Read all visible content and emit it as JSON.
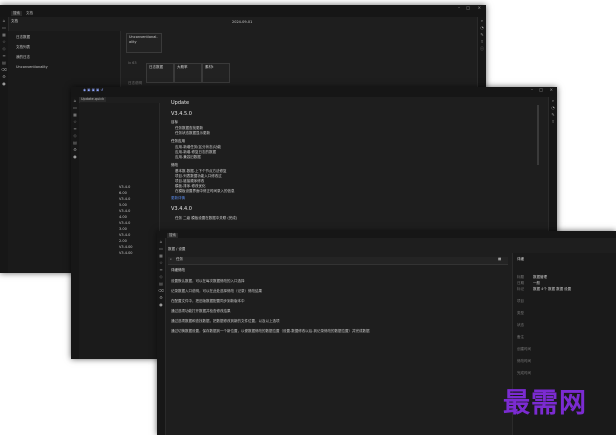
{
  "win1": {
    "tabs": [
      "搜索",
      "文档"
    ],
    "header_left": "文档",
    "header_center": "2024-09-01",
    "sidebar": {
      "items": [
        "日志数据",
        "文档列表",
        "我的日志",
        "Unconventionality"
      ]
    },
    "card_top": "Unconventional-ality",
    "counter": "lv 63",
    "cards": [
      "日志数据",
      "大概率",
      "素材t"
    ],
    "sub_label": "日志说明"
  },
  "win2": {
    "tab": "Update.quick",
    "doc": {
      "title": "Update",
      "v1": "V3.4.5.0",
      "s1": "目标",
      "b1": [
        "任务数据查找更新",
        "任务状态数据显示更新"
      ],
      "s2": "任务应用",
      "b2": [
        "应用-新增任务(区分状态)功能",
        "应用-新增-修复日志的数据",
        "应用-兼容旧数据"
      ],
      "s3": "修改",
      "b3": [
        "基本数-数据-上下个节点方法修复",
        "项目-列表数据功能入口修改过",
        "项目-链接顺序修改",
        "模板-排序-修改优化",
        "在模板设置界面中修正时间录入的信息"
      ],
      "link": "更新详情",
      "v2": "V3.4.4.0",
      "b4": [
        "任务 二级 模板设置在数据中关联 (完成)"
      ]
    },
    "left_versions": [
      "V3.4.0",
      "6.00",
      "V3.4.0",
      "5.00",
      "V3.4.0",
      "4.00",
      "V3.4.0",
      "3.00",
      "V3.4.0",
      "2.00",
      "V3.4.00",
      "V3.4.00"
    ]
  },
  "win3": {
    "tabs": [
      "搜索"
    ],
    "breadcrumb": "数据 / 设置",
    "search_value": "任务",
    "panel_title": "详细",
    "list_header": "详细修改",
    "rows": [
      "设置默认数据，可以在每次数据修改的入口选择",
      "记录数据入口说明，可以在此处选择修改（记录）修改结果",
      "在配置文件中，把旧版数据配置同步到新版本中",
      "通过选项功能打开数据并检查修改结果",
      "通过选项数据和查找数据，把数据修改到新的文件位置，以及以上选项",
      "通过切换数据设置，保存数据到一个新位置，以便数据修改的数据位置（设置-数据修改以后-到记录修改的数据位置）并完成数据"
    ],
    "right": {
      "title": "详细",
      "fields": [
        {
          "k": "标题",
          "v": "数据管理"
        },
        {
          "k": "日期",
          "v": "一般"
        },
        {
          "k": "标记",
          "v": "数据 4个 数据 数据 设置"
        },
        {
          "k": "项目",
          "v": ""
        },
        {
          "k": "类型",
          "v": ""
        },
        {
          "k": "状态",
          "v": ""
        },
        {
          "k": "备注",
          "v": ""
        },
        {
          "k": "创建时间",
          "v": ""
        },
        {
          "k": "修改时间",
          "v": ""
        },
        {
          "k": "完成时间",
          "v": ""
        }
      ]
    }
  },
  "watermark": "最需网"
}
